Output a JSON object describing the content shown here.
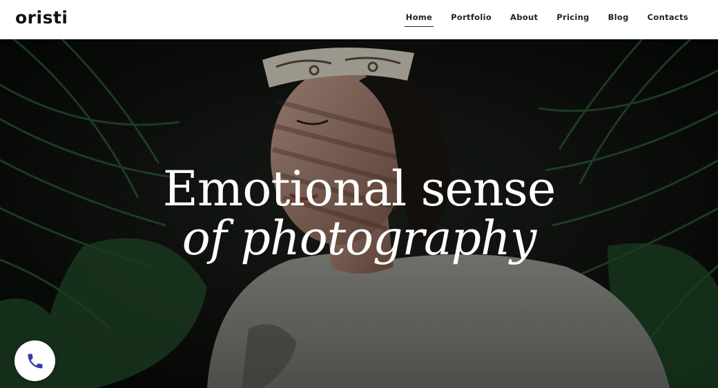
{
  "brand": {
    "logo_text": "oristi"
  },
  "nav": {
    "items": [
      {
        "label": "Home",
        "active": true
      },
      {
        "label": "Portfolio",
        "active": false
      },
      {
        "label": "About",
        "active": false
      },
      {
        "label": "Pricing",
        "active": false
      },
      {
        "label": "Blog",
        "active": false
      },
      {
        "label": "Contacts",
        "active": false
      }
    ]
  },
  "hero": {
    "title_line1": "Emotional sense",
    "title_line2": "of photography",
    "image_icon": "portrait-photo"
  },
  "call_button": {
    "icon": "phone-icon",
    "icon_color": "#3a3aa8"
  },
  "colors": {
    "text_dark": "#222222",
    "hero_text": "#ffffff",
    "header_bg": "#ffffff"
  }
}
